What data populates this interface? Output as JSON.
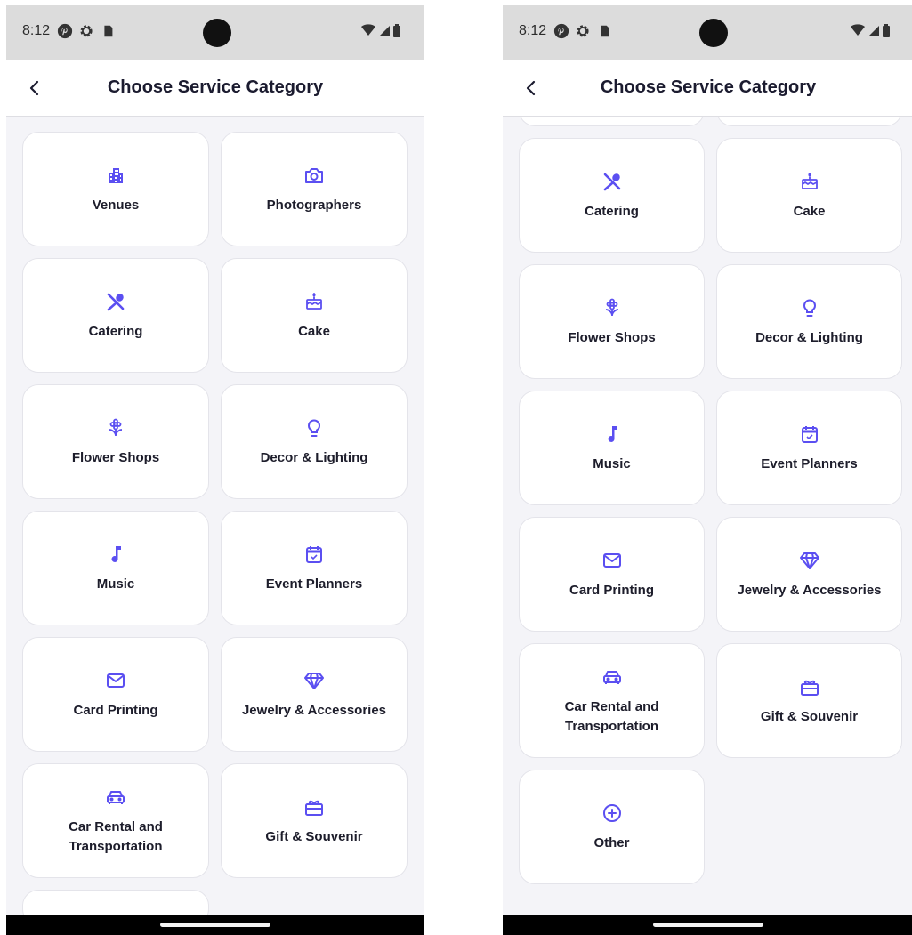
{
  "accent_color": "#5b4ff1",
  "status_bar": {
    "time": "8:12",
    "left_icons": [
      "pinterest-icon",
      "settings-icon",
      "sd-card-icon"
    ],
    "right_icons": [
      "wifi-icon",
      "signal-icon",
      "battery-icon"
    ]
  },
  "app_bar": {
    "back_icon": "chevron-left-icon",
    "title": "Choose Service Category"
  },
  "left_screen": {
    "categories": [
      {
        "label": "Venues",
        "icon": "building-icon"
      },
      {
        "label": "Photographers",
        "icon": "camera-icon"
      },
      {
        "label": "Catering",
        "icon": "fork-spoon-icon"
      },
      {
        "label": "Cake",
        "icon": "cake-icon"
      },
      {
        "label": "Flower Shops",
        "icon": "flower-icon"
      },
      {
        "label": "Decor & Lighting",
        "icon": "lightbulb-icon"
      },
      {
        "label": "Music",
        "icon": "music-note-icon"
      },
      {
        "label": "Event Planners",
        "icon": "calendar-check-icon"
      },
      {
        "label": "Card Printing",
        "icon": "envelope-icon"
      },
      {
        "label": "Jewelry & Accessories",
        "icon": "diamond-icon"
      },
      {
        "label": "Car Rental and Transportation",
        "icon": "car-icon"
      },
      {
        "label": "Gift & Souvenir",
        "icon": "gift-icon"
      }
    ]
  },
  "right_screen": {
    "categories": [
      {
        "label": "Catering",
        "icon": "fork-spoon-icon"
      },
      {
        "label": "Cake",
        "icon": "cake-icon"
      },
      {
        "label": "Flower Shops",
        "icon": "flower-icon"
      },
      {
        "label": "Decor & Lighting",
        "icon": "lightbulb-icon"
      },
      {
        "label": "Music",
        "icon": "music-note-icon"
      },
      {
        "label": "Event Planners",
        "icon": "calendar-check-icon"
      },
      {
        "label": "Card Printing",
        "icon": "envelope-icon"
      },
      {
        "label": "Jewelry & Accessories",
        "icon": "diamond-icon"
      },
      {
        "label": "Car Rental and Transportation",
        "icon": "car-icon"
      },
      {
        "label": "Gift & Souvenir",
        "icon": "gift-icon"
      },
      {
        "label": "Other",
        "icon": "plus-circle-icon"
      }
    ]
  }
}
